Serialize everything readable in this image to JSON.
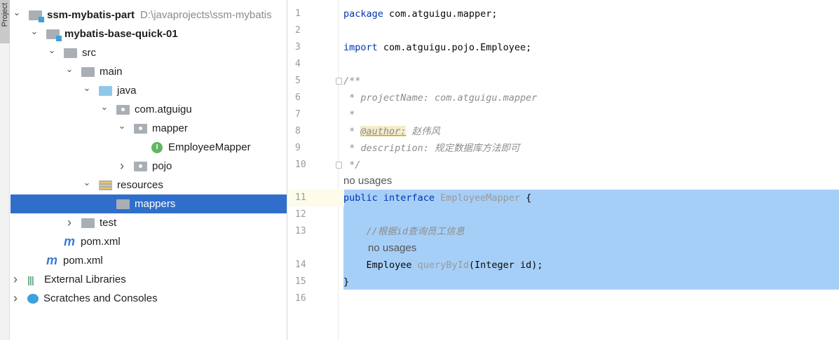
{
  "sidebar_tab": "Project",
  "tree": [
    {
      "label": "ssm-mybatis-part",
      "path": "D:\\javaprojects\\ssm-mybatis",
      "icon": "module-folder-icon",
      "expanded": true
    },
    {
      "label": "mybatis-base-quick-01",
      "icon": "module-folder-icon",
      "expanded": true
    },
    {
      "label": "src",
      "icon": "folder-icon",
      "expanded": true
    },
    {
      "label": "main",
      "icon": "folder-icon",
      "expanded": true
    },
    {
      "label": "java",
      "icon": "source-folder-icon",
      "expanded": true
    },
    {
      "label": "com.atguigu",
      "icon": "package-icon",
      "expanded": true
    },
    {
      "label": "mapper",
      "icon": "package-icon",
      "expanded": true
    },
    {
      "label": "EmployeeMapper",
      "icon": "interface-icon"
    },
    {
      "label": "pojo",
      "icon": "package-icon",
      "expanded": false
    },
    {
      "label": "resources",
      "icon": "resources-folder-icon",
      "expanded": true
    },
    {
      "label": "mappers",
      "icon": "folder-icon",
      "selected": true
    },
    {
      "label": "test",
      "icon": "folder-icon",
      "expanded": false
    },
    {
      "label": "pom.xml",
      "icon": "maven-icon"
    },
    {
      "label": "pom.xml",
      "icon": "maven-icon"
    },
    {
      "label": "External Libraries",
      "icon": "libraries-icon",
      "expanded": false
    },
    {
      "label": "Scratches and Consoles",
      "icon": "scratches-icon",
      "expanded": false
    }
  ],
  "code": {
    "l1a": "package",
    "l1b": " com.atguigu.mapper;",
    "l3a": "import",
    "l3b": " com.atguigu.pojo.Employee;",
    "l5": "/**",
    "l6": " * projectName: com.atguigu.mapper",
    "l7": " *",
    "l8a": " * ",
    "l8b": "@author:",
    "l8c": " 赵伟风",
    "l9": " * description: 规定数据库方法即可",
    "l10": " */",
    "hint": "no usages",
    "l11a": "public interface",
    "l11b": " EmployeeMapper",
    "l11c": " {",
    "l13": "    //根据id查询员工信息",
    "l14a": "    Employee ",
    "l14b": "queryById",
    "l14c": "(Integer id);",
    "l15": "}"
  },
  "line_numbers": [
    "1",
    "2",
    "3",
    "4",
    "5",
    "6",
    "7",
    "8",
    "9",
    "10",
    "11",
    "12",
    "13",
    "14",
    "15",
    "16"
  ]
}
